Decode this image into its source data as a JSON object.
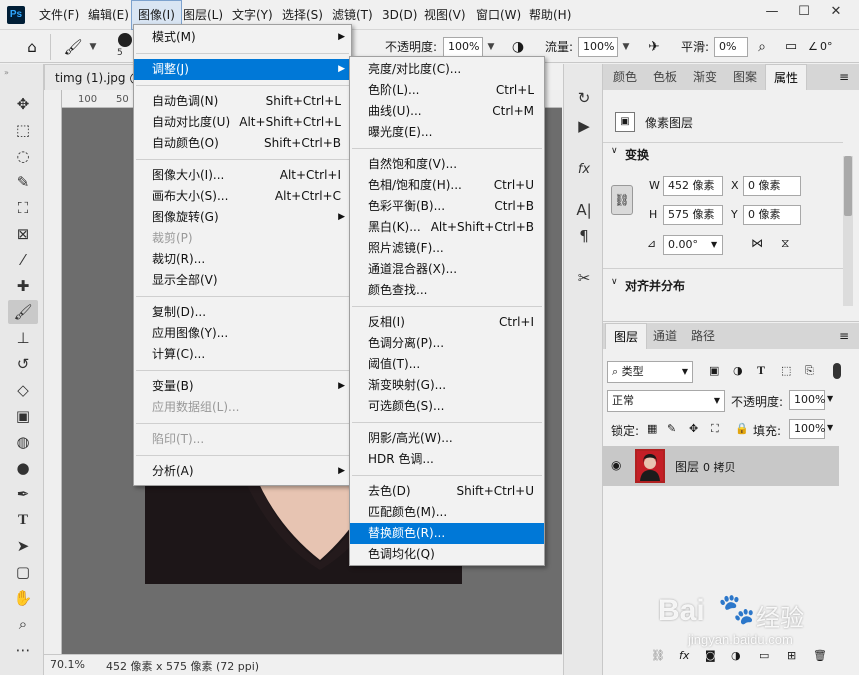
{
  "app": {
    "logo": "Ps"
  },
  "menubar": {
    "items": [
      "文件(F)",
      "编辑(E)",
      "图像(I)",
      "图层(L)",
      "文字(Y)",
      "选择(S)",
      "滤镜(T)",
      "3D(D)",
      "视图(V)",
      "窗口(W)",
      "帮助(H)"
    ],
    "window_controls": [
      "—",
      "☐",
      "✕"
    ]
  },
  "options": {
    "brush_size": "5",
    "opacity_label": "不透明度:",
    "opacity": "100%",
    "flow_label": "流量:",
    "flow": "100%",
    "smooth_label": "平滑:",
    "smooth": "0%",
    "angle": "0°"
  },
  "document": {
    "tab": "timg (1).jpg @",
    "ruler": [
      "100",
      "50"
    ],
    "zoom": "70.1%",
    "size": "452 像素 x 575 像素 (72 ppi)"
  },
  "image_menu": [
    {
      "label": "模式(M)",
      "arrow": true
    },
    {
      "sep": true
    },
    {
      "label": "调整(J)",
      "arrow": true,
      "hl": true
    },
    {
      "sep": true
    },
    {
      "label": "自动色调(N)",
      "shortcut": "Shift+Ctrl+L"
    },
    {
      "label": "自动对比度(U)",
      "shortcut": "Alt+Shift+Ctrl+L"
    },
    {
      "label": "自动颜色(O)",
      "shortcut": "Shift+Ctrl+B"
    },
    {
      "sep": true
    },
    {
      "label": "图像大小(I)...",
      "shortcut": "Alt+Ctrl+I"
    },
    {
      "label": "画布大小(S)...",
      "shortcut": "Alt+Ctrl+C"
    },
    {
      "label": "图像旋转(G)",
      "arrow": true
    },
    {
      "label": "裁剪(P)",
      "dis": true
    },
    {
      "label": "裁切(R)..."
    },
    {
      "label": "显示全部(V)"
    },
    {
      "sep": true
    },
    {
      "label": "复制(D)..."
    },
    {
      "label": "应用图像(Y)..."
    },
    {
      "label": "计算(C)..."
    },
    {
      "sep": true
    },
    {
      "label": "变量(B)",
      "arrow": true
    },
    {
      "label": "应用数据组(L)...",
      "dis": true
    },
    {
      "sep": true
    },
    {
      "label": "陷印(T)...",
      "dis": true
    },
    {
      "sep": true
    },
    {
      "label": "分析(A)",
      "arrow": true
    }
  ],
  "adjust_menu": [
    {
      "label": "亮度/对比度(C)..."
    },
    {
      "label": "色阶(L)...",
      "shortcut": "Ctrl+L"
    },
    {
      "label": "曲线(U)...",
      "shortcut": "Ctrl+M"
    },
    {
      "label": "曝光度(E)..."
    },
    {
      "sep": true
    },
    {
      "label": "自然饱和度(V)..."
    },
    {
      "label": "色相/饱和度(H)...",
      "shortcut": "Ctrl+U"
    },
    {
      "label": "色彩平衡(B)...",
      "shortcut": "Ctrl+B"
    },
    {
      "label": "黑白(K)...",
      "shortcut": "Alt+Shift+Ctrl+B"
    },
    {
      "label": "照片滤镜(F)..."
    },
    {
      "label": "通道混合器(X)..."
    },
    {
      "label": "颜色查找..."
    },
    {
      "sep": true
    },
    {
      "label": "反相(I)",
      "shortcut": "Ctrl+I"
    },
    {
      "label": "色调分离(P)..."
    },
    {
      "label": "阈值(T)..."
    },
    {
      "label": "渐变映射(G)..."
    },
    {
      "label": "可选颜色(S)..."
    },
    {
      "sep": true
    },
    {
      "label": "阴影/高光(W)..."
    },
    {
      "label": "HDR 色调..."
    },
    {
      "sep": true
    },
    {
      "label": "去色(D)",
      "shortcut": "Shift+Ctrl+U"
    },
    {
      "label": "匹配颜色(M)..."
    },
    {
      "label": "替换颜色(R)...",
      "hl": true
    },
    {
      "label": "色调均化(Q)"
    }
  ],
  "properties": {
    "tabs": [
      "颜色",
      "色板",
      "渐变",
      "图案",
      "属性"
    ],
    "type": "像素图层",
    "transform": "变换",
    "w_label": "W",
    "w": "452 像素",
    "x_label": "X",
    "x": "0 像素",
    "h_label": "H",
    "h": "575 像素",
    "y_label": "Y",
    "y": "0 像素",
    "angle": "0.00°",
    "align": "对齐并分布"
  },
  "layers": {
    "tabs": [
      "图层",
      "通道",
      "路径"
    ],
    "filter": "类型",
    "filter_icons": [
      "T"
    ],
    "blend": "正常",
    "opacity_label": "不透明度:",
    "opacity": "100%",
    "lock_label": "锁定:",
    "fill_label": "填充:",
    "fill": "100%",
    "layer_name": "图层",
    "layer_suffix": "0 拷贝"
  },
  "watermark": {
    "brand": "Bai",
    "brand2": "经验",
    "url": "jingyan.baidu.com"
  }
}
